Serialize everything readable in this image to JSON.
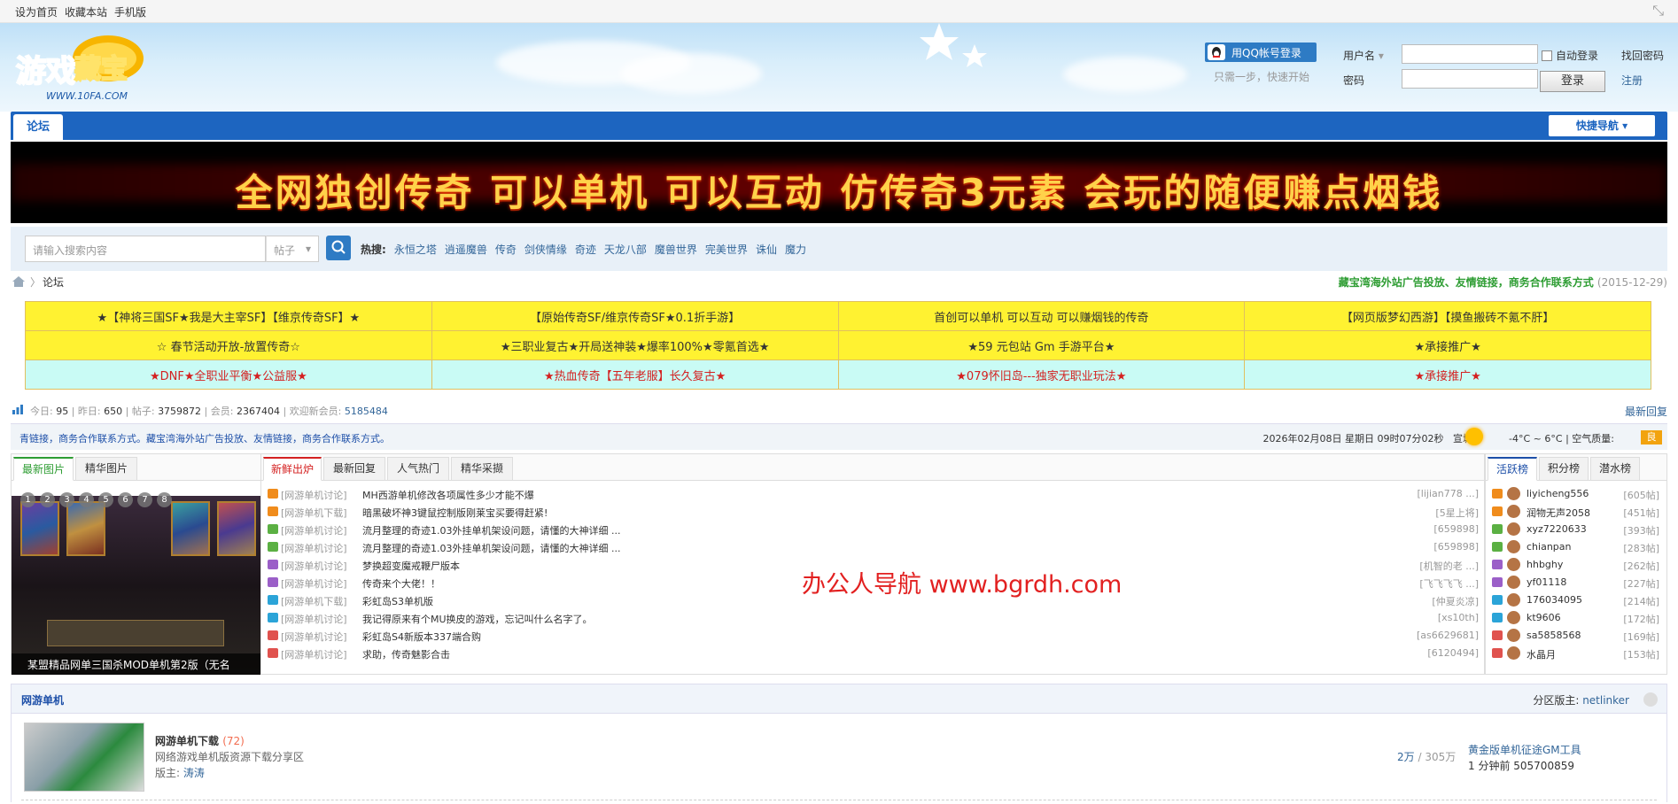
{
  "topbar": {
    "links": [
      "设为首页",
      "收藏本站",
      "手机版"
    ]
  },
  "login": {
    "qq_button": "用QQ帐号登录",
    "qq_sub": "只需一步，快速开始",
    "username_label": "用户名",
    "password_label": "密码",
    "auto_login": "自动登录",
    "login_button": "登录",
    "forgot": "找回密码",
    "register": "注册"
  },
  "nav": {
    "tab": "论坛",
    "quick_nav": "快捷导航"
  },
  "banner": {
    "text": "全网独创传奇 可以单机 可以互动 仿传奇3元素 会玩的随便赚点烟钱"
  },
  "search": {
    "placeholder": "请输入搜索内容",
    "type": "帖子",
    "hot_label": "热搜:",
    "hot": [
      "永恒之塔",
      "逍遥魔兽",
      "传奇",
      "剑侠情缘",
      "奇迹",
      "天龙八部",
      "魔兽世界",
      "完美世界",
      "诛仙",
      "魔力"
    ]
  },
  "breadcrumb": {
    "current": "论坛",
    "notice": "藏宝湾海外站广告投放、友情链接，商务合作联系方式",
    "date": "(2015-12-29)"
  },
  "ads": [
    [
      "★【神将三国SF★我是大主宰SF】【维京传奇SF】★",
      "【原始传奇SF/维京传奇SF★0.1折手游】",
      "首创可以单机 可以互动 可以赚烟钱的传奇",
      "【网页版梦幻西游】【摸鱼搬砖不氪不肝】"
    ],
    [
      "☆ 春节活动开放-放置传奇☆",
      "★三职业复古★开局送神装★爆率100%★零氪首选★",
      "★59 元包站 Gm 手游平台★",
      "★承接推广★"
    ],
    [
      "★DNF★全职业平衡★公益服★",
      "★热血传奇【五年老服】长久复古★",
      "★079怀旧岛---独家无职业玩法★",
      "★承接推广★"
    ]
  ],
  "ad_colors": [
    "#333333",
    "#d42020"
  ],
  "stats": {
    "today_label": "今日:",
    "today": "95",
    "yesterday_label": "昨日:",
    "yesterday": "650",
    "posts_label": "帖子:",
    "posts": "3759872",
    "members_label": "会员:",
    "members": "2367404",
    "welcome_label": "欢迎新会员:",
    "welcome": "5185484",
    "latest_reply": "最新回复"
  },
  "notice_bar": {
    "text": "青链接，商务合作联系方式。藏宝湾海外站广告投放、友情链接，商务合作联系方式。",
    "datetime": "2026年02月08日 星期日 09时07分02秒",
    "city": "宣城",
    "temp": "-4°C ~ 6°C",
    "aq_label": "空气质量:",
    "aq": "良"
  },
  "pics": {
    "tabs": [
      "最新图片",
      "精华图片"
    ],
    "dots": [
      "1",
      "2",
      "3",
      "4",
      "5",
      "6",
      "7",
      "8"
    ],
    "caption": "某盟精品网单三国杀MOD单机第2版（无名"
  },
  "threads": {
    "tabs": [
      "新鲜出炉",
      "最新回复",
      "人气热门",
      "精华采撷"
    ],
    "rows": [
      {
        "cat": "[网游单机讨论]",
        "title": "MH西游单机修改各项属性多少才能不爆",
        "author": "[lijian778 ...]"
      },
      {
        "cat": "[网游单机下载]",
        "title": "暗黑破坏神3键鼠控制版刚莱宝买要得赶紧!",
        "author": "[5星上将]"
      },
      {
        "cat": "[网游单机讨论]",
        "title": "流月整理的奇迹1.03外挂单机架设问题，请懂的大神详细 ...",
        "author": "[659898]"
      },
      {
        "cat": "[网游单机讨论]",
        "title": "流月整理的奇迹1.03外挂单机架设问题，请懂的大神详细 ...",
        "author": "[659898]"
      },
      {
        "cat": "[网游单机讨论]",
        "title": "梦换超变魔戒鞭尸版本",
        "author": "[机智的老 ...]"
      },
      {
        "cat": "[网游单机讨论]",
        "title": "传奇来个大佬！！",
        "author": "[飞飞飞飞 ...]"
      },
      {
        "cat": "[网游单机下载]",
        "title": "彩虹岛S3单机版",
        "author": "[仲夏炎凉]"
      },
      {
        "cat": "[网游单机讨论]",
        "title": "我记得原来有个MU换皮的游戏，忘记叫什么名字了。",
        "author": "[xs10th]"
      },
      {
        "cat": "[网游单机讨论]",
        "title": "彩虹岛S4新版本337端合购",
        "author": "[as6629681]"
      },
      {
        "cat": "[网游单机讨论]",
        "title": "求助，传奇魅影合击",
        "author": "[6120494]"
      }
    ]
  },
  "icon_colors": [
    "#f08c1c",
    "#f08c1c",
    "#5bb043",
    "#5bb043",
    "#9b5fc8",
    "#9b5fc8",
    "#2ba4d8",
    "#2ba4d8",
    "#e0524e",
    "#e0524e"
  ],
  "ranking": {
    "tabs": [
      "活跃榜",
      "积分榜",
      "潜水榜"
    ],
    "rows": [
      {
        "name": "liyicheng556",
        "count": "[605帖]"
      },
      {
        "name": "润物无声2058",
        "count": "[451帖]"
      },
      {
        "name": "xyz7220633",
        "count": "[393帖]"
      },
      {
        "name": "chianpan",
        "count": "[283帖]"
      },
      {
        "name": "hhbghy",
        "count": "[262帖]"
      },
      {
        "name": "yf01118",
        "count": "[227帖]"
      },
      {
        "name": "176034095",
        "count": "[214帖]"
      },
      {
        "name": "kt9606",
        "count": "[172帖]"
      },
      {
        "name": "sa5858568",
        "count": "[169帖]"
      },
      {
        "name": "水晶月",
        "count": "[153帖]"
      }
    ]
  },
  "watermark": "办公人导航  www.bgrdh.com",
  "forum": {
    "section": "网游单机",
    "moderator_label": "分区版主:",
    "moderator": "netlinker",
    "board_name": "网游单机下载",
    "board_count": "(72)",
    "board_desc": "网络游戏单机版资源下载分享区",
    "board_mod_label": "版主:",
    "board_mod": "涛涛",
    "threads": "2万",
    "posts": "305万",
    "last_title": "黄金版单机征途GM工具",
    "last_info": "1 分钟前 505700859"
  }
}
